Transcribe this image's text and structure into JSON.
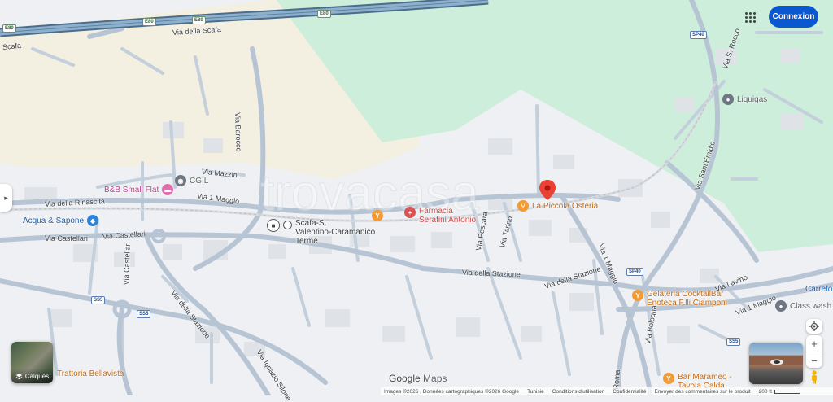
{
  "header": {
    "connexion_label": "Connexion",
    "apps_icon": "apps-grid-icon"
  },
  "roads": {
    "e80_top": "E80",
    "e80_b": "E80",
    "e80_c": "E80",
    "e80_d": "E80",
    "via_della_scafa_1": "Via della Scafa",
    "via_della_scafa_2": "Scafa",
    "via_barocco": "Via Barocco",
    "via_mazzini": "Via Mazzini",
    "via_1_maggio_w": "Via 1 Maggio",
    "via_della_rinascita": "Via della Rinascita",
    "via_castellari_1": "Via Castellari",
    "via_castellari_2": "Via Castellari",
    "via_castellari_v": "Via Castellari",
    "via_della_stazione_1": "Via della Stazione",
    "via_della_stazione_2": "Via della Stazione",
    "via_della_stazione_3": "Via della Stazione",
    "via_pescara": "Via Pescara",
    "via_tarino": "Via Tarino",
    "via_1_maggio_e": "Via 1 Maggio",
    "via_1_maggio_se": "Via 1 Maggio",
    "via_s_rocco": "Via S. Rocco",
    "via_sant_emidio": "Via Sant'Emidio",
    "via_lavino": "Via Lavino",
    "via_bologna": "Via Bologna",
    "via_ignazio_silone": "Via Ignazio Silone",
    "via_roma": "Roma",
    "sp40_a": "SP40",
    "sp40_b": "SP40",
    "ss5_a": "SS5",
    "ss5_b": "SS5",
    "ss5_c": "SS5"
  },
  "pois": {
    "bb_small_flat": "B&B Small Flat",
    "cgil": "CGIL",
    "acqua_sapone": "Acqua & Sapone",
    "station_line1": "Scafa-S.",
    "station_line2": "Valentino-Caramanico",
    "station_line3": "Terme",
    "farmacia_line1": "Farmacia",
    "farmacia_line2": "Serafini Antonio",
    "la_piccola_osteria": "La Piccola Osteria",
    "liquigas": "Liquigas",
    "gelateria_line1": "Gelateria CocktailBar",
    "gelateria_line2": "Enoteca F.lli Ciamponi",
    "class_wash": "Class wash",
    "carrefour": "Carrefo",
    "bar_marameo_line1": "Bar Marameo -",
    "bar_marameo_line2": "Tavola Calda",
    "trattoria_bellavista": "Trattoria Bellavista"
  },
  "watermark": "trovacasa",
  "controls": {
    "layers_label": "Calques",
    "zoom_in": "+",
    "zoom_out": "−",
    "side_toggle": "▸"
  },
  "branding": {
    "google": "Google",
    "maps": "Maps"
  },
  "footer": {
    "imagery": "Images ©2026 , Données cartographiques ©2026 Google",
    "country": "Tunisie",
    "terms": "Conditions d'utilisation",
    "privacy": "Confidentialité",
    "feedback": "Envoyer des commentaires sur le produit",
    "scale": "200 ft"
  },
  "colors": {
    "green_area": "#cdeedb",
    "beige_area": "#f3efe1",
    "road": "#c4cfdc",
    "road_major": "#9aadc4",
    "highway": "#4a6d8c",
    "button_blue": "#0b57d0",
    "pin_red": "#ea4335",
    "poi_orange": "#f29b34",
    "poi_pink": "#e06fb0",
    "poi_blue": "#2b84d8",
    "poi_red": "#d95454",
    "poi_gray": "#6f7782"
  }
}
